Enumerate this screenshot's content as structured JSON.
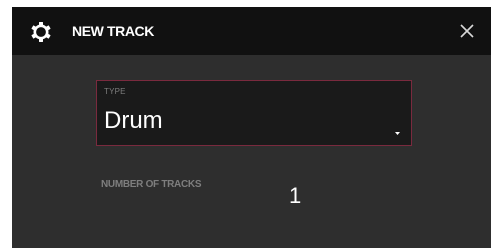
{
  "dialog": {
    "title": "NEW TRACK",
    "icons": {
      "settings": "gear-icon",
      "close": "close-icon",
      "dropdown": "chevron-down-icon"
    }
  },
  "type_field": {
    "label": "TYPE",
    "value": "Drum"
  },
  "tracks": {
    "label": "NUMBER OF TRACKS",
    "value": "1"
  },
  "colors": {
    "background": "#2e2e2e",
    "header": "#111111",
    "field_background": "#1a1a1a",
    "accent_border": "#7a2a3e",
    "muted_text": "#7e7e7e",
    "text": "#ffffff"
  }
}
